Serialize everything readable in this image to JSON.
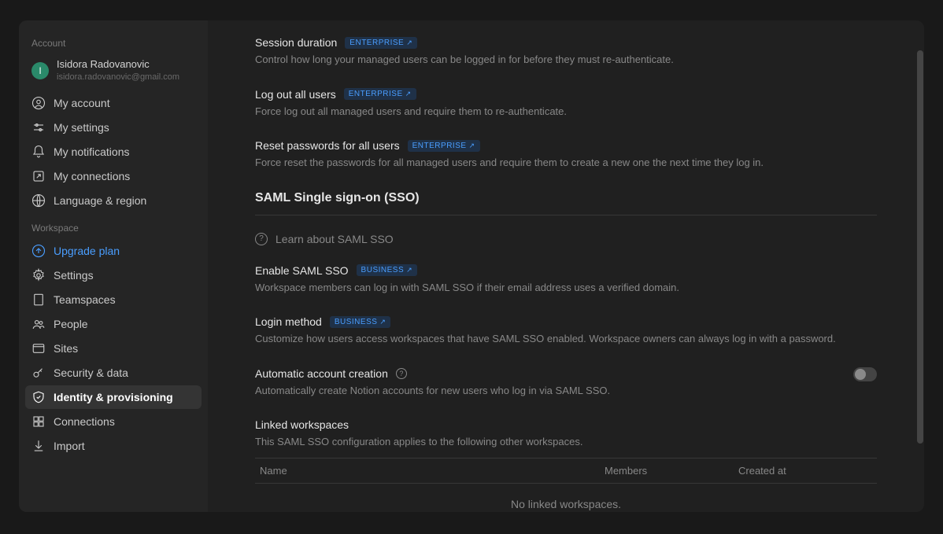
{
  "sidebar": {
    "account_label": "Account",
    "user": {
      "initial": "I",
      "name": "Isidora Radovanovic",
      "email": "isidora.radovanovic@gmail.com"
    },
    "account_items": [
      {
        "label": "My account"
      },
      {
        "label": "My settings"
      },
      {
        "label": "My notifications"
      },
      {
        "label": "My connections"
      },
      {
        "label": "Language & region"
      }
    ],
    "workspace_label": "Workspace",
    "workspace_items": [
      {
        "label": "Upgrade plan"
      },
      {
        "label": "Settings"
      },
      {
        "label": "Teamspaces"
      },
      {
        "label": "People"
      },
      {
        "label": "Sites"
      },
      {
        "label": "Security & data"
      },
      {
        "label": "Identity & provisioning"
      },
      {
        "label": "Connections"
      },
      {
        "label": "Import"
      }
    ]
  },
  "content": {
    "badges": {
      "enterprise": "ENTERPRISE",
      "business": "BUSINESS",
      "arrow": "↗"
    },
    "session": {
      "title": "Session duration",
      "desc": "Control how long your managed users can be logged in for before they must re-authenticate."
    },
    "logout": {
      "title": "Log out all users",
      "desc": "Force log out all managed users and require them to re-authenticate."
    },
    "reset": {
      "title": "Reset passwords for all users",
      "desc": "Force reset the passwords for all managed users and require them to create a new one the next time they log in."
    },
    "sso": {
      "heading": "SAML Single sign-on (SSO)",
      "learn": "Learn about SAML SSO",
      "enable": {
        "title": "Enable SAML SSO",
        "desc": "Workspace members can log in with SAML SSO if their email address uses a verified domain."
      },
      "login": {
        "title": "Login method",
        "desc": "Customize how users access workspaces that have SAML SSO enabled. Workspace owners can always log in with a password."
      },
      "auto": {
        "title": "Automatic account creation",
        "desc": "Automatically create Notion accounts for new users who log in via SAML SSO."
      },
      "linked": {
        "title": "Linked workspaces",
        "desc": "This SAML SSO configuration applies to the following other workspaces."
      },
      "table": {
        "name": "Name",
        "members": "Members",
        "created": "Created at",
        "empty": "No linked workspaces."
      }
    }
  }
}
